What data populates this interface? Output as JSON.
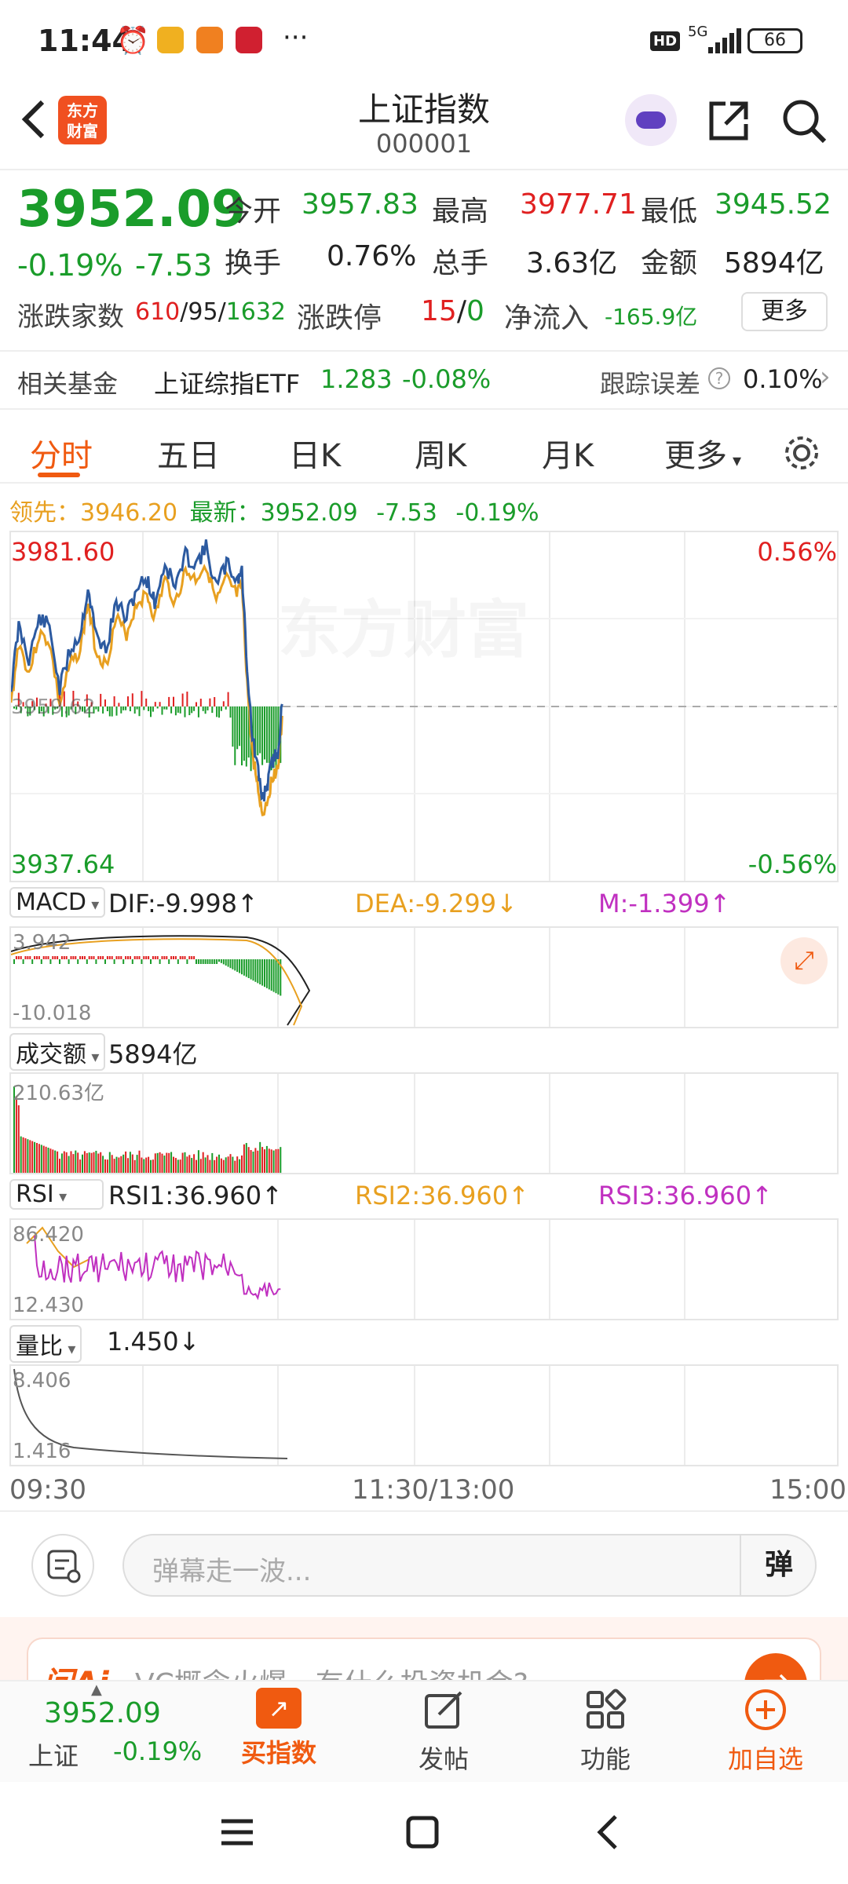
{
  "status_bar": {
    "time": "11:44",
    "dots": "···",
    "network": "5G",
    "battery": "66",
    "hd": "HD"
  },
  "header": {
    "title": "上证指数",
    "code": "000001",
    "logo_text": "东方财富"
  },
  "quote": {
    "price": "3952.09",
    "pct": "-0.19%",
    "chg": "-7.53",
    "open_label": "今开",
    "open": "3957.83",
    "high_label": "最高",
    "high": "3977.71",
    "low_label": "最低",
    "low": "3945.52",
    "turnover_label": "换手",
    "turnover": "0.76%",
    "volume_label": "总手",
    "volume": "3.63亿",
    "amount_label": "金额",
    "amount": "5894亿",
    "breadth_label": "涨跌家数",
    "up": "610",
    "flat": "95",
    "down": "1632",
    "slash": "/",
    "limit_label": "涨跌停",
    "limit_up": "15",
    "limit_down": "0",
    "netflow_label": "净流入",
    "netflow": "-165.9亿",
    "more": "更多"
  },
  "fund": {
    "label": "相关基金",
    "name": "上证综指ETF",
    "price": "1.283",
    "pct": "-0.08%",
    "tracking_label": "跟踪误差",
    "tracking": "0.10%"
  },
  "tabs": [
    "分时",
    "五日",
    "日K",
    "周K",
    "月K",
    "更多"
  ],
  "legend": {
    "lead_label": "领先：",
    "lead": "3946.20",
    "latest_label": "最新：",
    "latest": "3952.09",
    "chg": "-7.53",
    "pct": "-0.19%"
  },
  "main_chart": {
    "top": "3981.60",
    "bottom": "3937.64",
    "top_pct": "0.56%",
    "bottom_pct": "-0.56%",
    "watermark": "东方财富",
    "prev_close_label": "3959.62"
  },
  "macd": {
    "name": "MACD",
    "dif": "DIF:-9.998↑",
    "dea": "DEA:-9.299↓",
    "m": "M:-1.399↑",
    "top": "3.942",
    "bottom": "-10.018"
  },
  "vol": {
    "name": "成交额",
    "value": "5894亿",
    "top": "210.63亿"
  },
  "rsi": {
    "name": "RSI",
    "rsi1": "RSI1:36.960↑",
    "rsi2": "RSI2:36.960↑",
    "rsi3": "RSI3:36.960↑",
    "top": "86.420",
    "bottom": "12.430"
  },
  "lb": {
    "name": "量比",
    "value": "1.450↓",
    "top": "8.406",
    "bottom": "1.416"
  },
  "time_axis": {
    "start": "09:30",
    "mid": "11:30/13:00",
    "end": "15:00"
  },
  "danmu": {
    "placeholder": "弹幕走一波...",
    "button": "弹"
  },
  "ai_banner": {
    "logo": "问Ai",
    "text": "VC概念火爆，有什么投资机会?"
  },
  "bottom_nav": {
    "price": "3952.09",
    "name": "上证",
    "pct": "-0.19%",
    "buy": "买指数",
    "post": "发帖",
    "func": "功能",
    "add": "加自选"
  },
  "colors": {
    "red": "#e02020",
    "green": "#1a9c2a",
    "orange": "#e8a020",
    "blue": "#2c5aa0",
    "purple": "#c030c0"
  }
}
